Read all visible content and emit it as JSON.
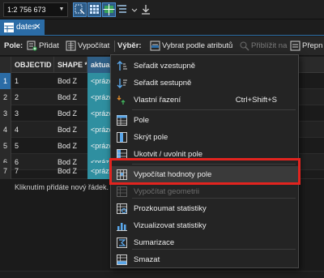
{
  "toolbar": {
    "scale_value": "1:2 756 673",
    "icons": [
      "scale-dropdown-icon",
      "select-by-rectangle-icon",
      "grid-icon",
      "map-crosshair-icon",
      "layer-list-icon",
      "download-icon"
    ]
  },
  "tab": {
    "label": "dates",
    "close": "✕"
  },
  "fieldbar": {
    "pole_label": "Pole:",
    "pridat": "Přidat",
    "vypocitat": "Vypočítat",
    "vyber_label": "Výběr:",
    "vybrat_podle": "Vybrat podle atributů",
    "priblizit": "Přiblížit na",
    "prepnout": "Přepn"
  },
  "table": {
    "columns": [
      "OBJECTID *",
      "SHAPE *",
      "aktual"
    ],
    "rows": [
      {
        "num": "1",
        "objectid": "1",
        "shape": "Bod Z",
        "aktual": "<prázd"
      },
      {
        "num": "2",
        "objectid": "2",
        "shape": "Bod Z",
        "aktual": "<prázd"
      },
      {
        "num": "3",
        "objectid": "3",
        "shape": "Bod Z",
        "aktual": "<prázd"
      },
      {
        "num": "4",
        "objectid": "4",
        "shape": "Bod Z",
        "aktual": "<prázd"
      },
      {
        "num": "5",
        "objectid": "5",
        "shape": "Bod Z",
        "aktual": "<prázd"
      },
      {
        "num": "6",
        "objectid": "6",
        "shape": "Bod Z",
        "aktual": "<prázd"
      },
      {
        "num": "7",
        "objectid": "7",
        "shape": "Bod Z",
        "aktual": "<prázd"
      }
    ],
    "new_row_hint": "Kliknutím přidáte nový řádek."
  },
  "menu": {
    "items": [
      {
        "label": "Seřadit vzestupně",
        "icon": "sort-ascending-icon"
      },
      {
        "label": "Seřadit sestupně",
        "icon": "sort-descending-icon"
      },
      {
        "label": "Vlastní řazení",
        "shortcut": "Ctrl+Shift+S",
        "icon": "custom-sort-icon"
      },
      {
        "label": "Pole",
        "icon": "fields-icon"
      },
      {
        "label": "Skrýt pole",
        "icon": "hide-field-icon"
      },
      {
        "label": "Ukotvit / uvolnit pole",
        "icon": "freeze-field-icon"
      },
      {
        "label": "Vypočítat hodnoty pole",
        "icon": "calculate-field-icon"
      },
      {
        "label": "Vypočítat geometrii",
        "icon": "calculate-geometry-icon",
        "disabled": true
      },
      {
        "label": "Prozkoumat statistiky",
        "icon": "explore-statistics-icon"
      },
      {
        "label": "Vizualizovat statistiky",
        "icon": "visualize-statistics-icon"
      },
      {
        "label": "Sumarizace",
        "icon": "summarize-icon"
      },
      {
        "label": "Smazat",
        "icon": "delete-icon"
      }
    ]
  },
  "colors": {
    "accent": "#2b6ca6",
    "aktual_column": "#2f8fa0",
    "highlight_box": "#e2241f"
  }
}
